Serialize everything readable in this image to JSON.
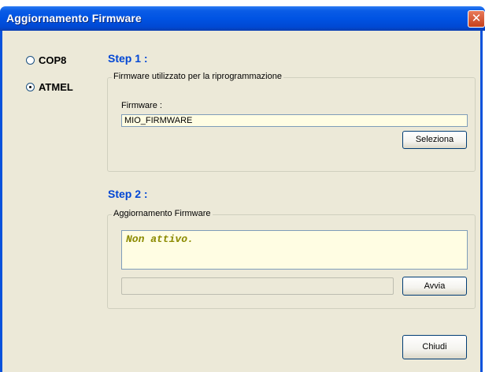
{
  "window": {
    "title": "Aggiornamento Firmware",
    "close_glyph": "✕"
  },
  "chip": {
    "options": [
      {
        "label": "COP8",
        "selected": false
      },
      {
        "label": "ATMEL",
        "selected": true
      }
    ]
  },
  "step1": {
    "heading": "Step 1 :",
    "group_title": "Firmware utilizzato per la riprogrammazione",
    "firmware_label": "Firmware :",
    "firmware_value": "MIO_FIRMWARE",
    "select_button": "Seleziona"
  },
  "step2": {
    "heading": "Step 2 :",
    "group_title": "Aggiornamento Firmware",
    "status_text": "Non attivo.",
    "progress_percent": 0,
    "start_button": "Avvia"
  },
  "footer": {
    "close_button": "Chiudi"
  },
  "colors": {
    "titlebar": "#0053e3",
    "step_heading": "#0046d5",
    "status_text": "#8b8a00",
    "field_bg": "#fffde3",
    "dialog_bg": "#ece9d8"
  },
  "icons": {
    "close": "close-icon",
    "radio": "radio-icon"
  }
}
